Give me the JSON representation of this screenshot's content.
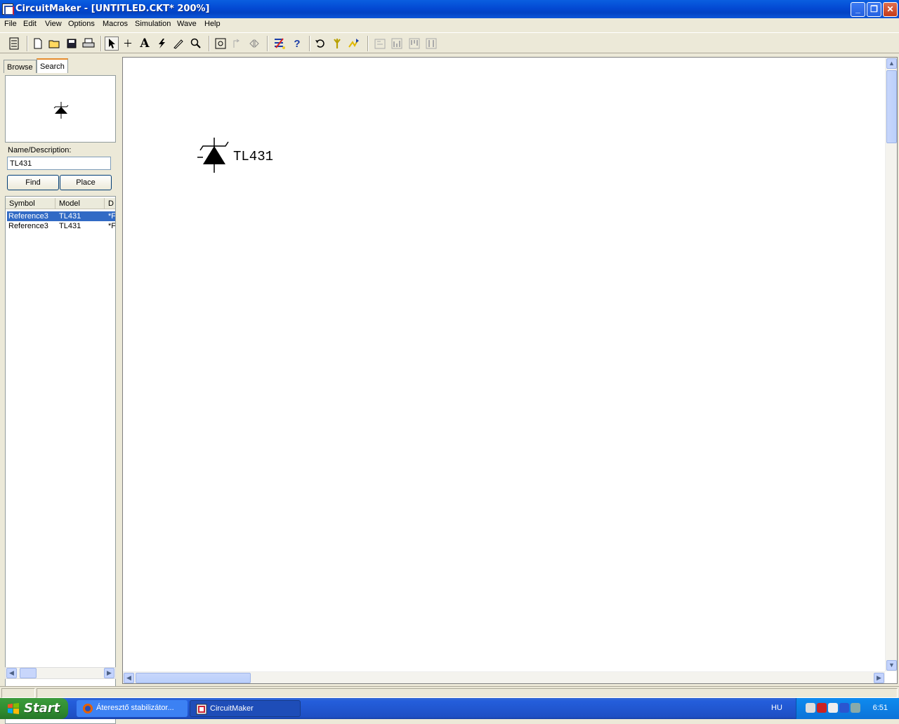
{
  "window": {
    "title": "CircuitMaker - [UNTITLED.CKT* 200%]",
    "minimize": "_",
    "maximize": "❐",
    "close": "✕"
  },
  "menu": [
    "File",
    "Edit",
    "View",
    "Options",
    "Macros",
    "Simulation",
    "Wave",
    "Help"
  ],
  "library_panel": {
    "tabs": {
      "browse": "Browse",
      "search": "Search"
    },
    "name_label": "Name/Description:",
    "name_value": "TL431",
    "find_button": "Find",
    "place_button": "Place",
    "columns": {
      "symbol": "Symbol",
      "model": "Model",
      "desc": "D"
    },
    "results": [
      {
        "symbol": "Reference3",
        "model": "TL431",
        "desc": "*F"
      },
      {
        "symbol": "Reference3",
        "model": "TL431",
        "desc": "*F"
      }
    ]
  },
  "canvas": {
    "component_label": "TL431"
  },
  "taskbar": {
    "start": "Start",
    "items": [
      {
        "label": "Áteresztő stabilizátor..."
      },
      {
        "label": "CircuitMaker"
      }
    ],
    "language": "HU",
    "clock": "6:51"
  },
  "colors": {
    "title_bar": "#0349d3",
    "selection": "#316ac5",
    "taskbar": "#245edb",
    "start_button": "#2f8b2f"
  }
}
